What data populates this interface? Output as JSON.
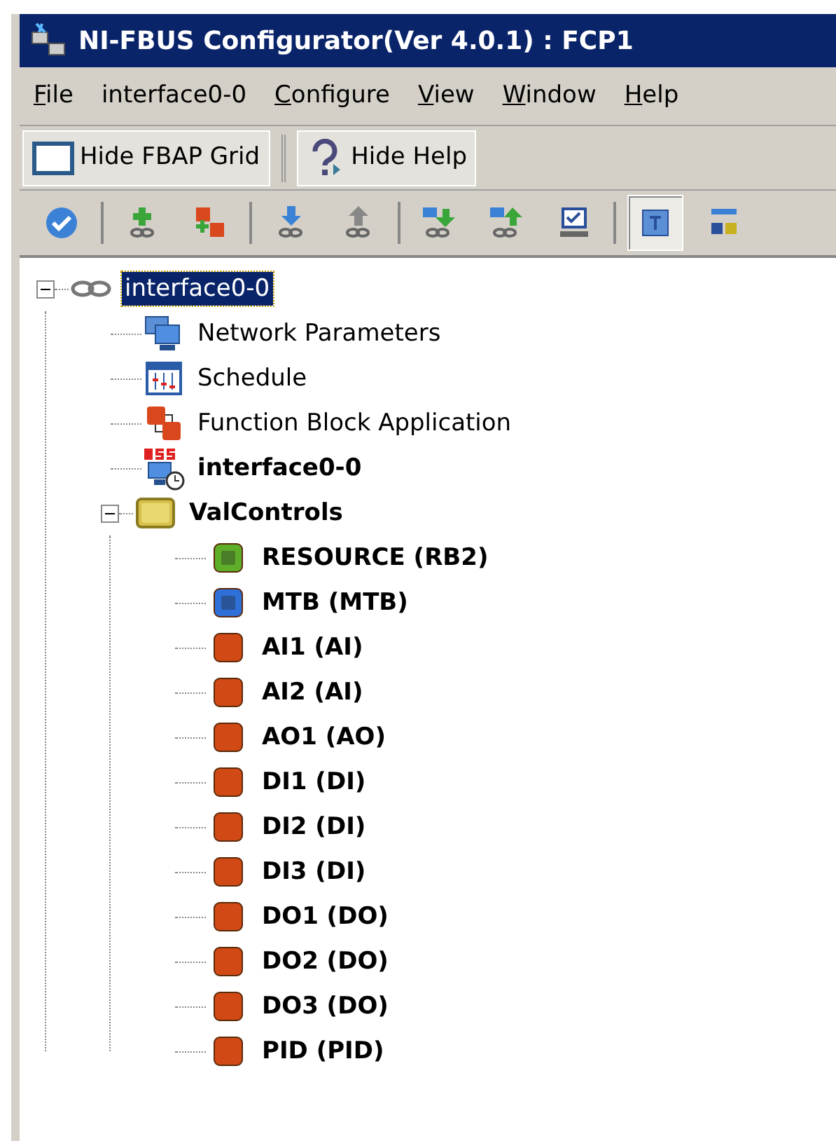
{
  "window": {
    "title": "NI-FBUS Configurator(Ver 4.0.1) : FCP1"
  },
  "menu": [
    {
      "label": "File",
      "mnemonic": true
    },
    {
      "label": "interface0-0",
      "mnemonic": false
    },
    {
      "label": "Configure",
      "mnemonic": true
    },
    {
      "label": "View",
      "mnemonic": true
    },
    {
      "label": "Window",
      "mnemonic": true
    },
    {
      "label": "Help",
      "mnemonic": true
    }
  ],
  "toolbar": [
    {
      "label": "Hide FBAP Grid",
      "kind": "window"
    },
    {
      "label": "Hide Help",
      "kind": "help"
    }
  ],
  "icon_toolbar": [
    {
      "kind": "check",
      "pressed": false
    },
    {
      "kind": "sep"
    },
    {
      "kind": "add-link",
      "pressed": false
    },
    {
      "kind": "add-block",
      "pressed": false
    },
    {
      "kind": "sep"
    },
    {
      "kind": "download",
      "pressed": false
    },
    {
      "kind": "upload",
      "pressed": false
    },
    {
      "kind": "sep"
    },
    {
      "kind": "net-down",
      "pressed": false
    },
    {
      "kind": "net-up",
      "pressed": false
    },
    {
      "kind": "monitor-check",
      "pressed": false
    },
    {
      "kind": "sep"
    },
    {
      "kind": "tag",
      "pressed": true
    },
    {
      "kind": "grid",
      "pressed": false
    }
  ],
  "tree": [
    {
      "label": "interface0-0",
      "kind": "link",
      "bold": false,
      "selected": true,
      "expanded": true,
      "children": [
        {
          "label": "Network Parameters",
          "kind": "network",
          "bold": false,
          "selected": false
        },
        {
          "label": "Schedule",
          "kind": "schedule",
          "bold": false,
          "selected": false
        },
        {
          "label": "Function Block Application",
          "kind": "fba",
          "bold": false,
          "selected": false
        },
        {
          "label": "interface0-0",
          "kind": "las",
          "bold": true,
          "selected": false
        },
        {
          "label": "ValControls",
          "kind": "folder",
          "bold": true,
          "selected": false,
          "expanded": true,
          "children": [
            {
              "label": "RESOURCE (RB2)",
              "kind": "resource",
              "bold": true,
              "selected": false
            },
            {
              "label": "MTB (MTB)",
              "kind": "transducer",
              "bold": true,
              "selected": false
            },
            {
              "label": "AI1 (AI)",
              "kind": "block",
              "bold": true,
              "selected": false
            },
            {
              "label": "AI2 (AI)",
              "kind": "block",
              "bold": true,
              "selected": false
            },
            {
              "label": "AO1 (AO)",
              "kind": "block",
              "bold": true,
              "selected": false
            },
            {
              "label": "DI1 (DI)",
              "kind": "block",
              "bold": true,
              "selected": false
            },
            {
              "label": "DI2 (DI)",
              "kind": "block",
              "bold": true,
              "selected": false
            },
            {
              "label": "DI3 (DI)",
              "kind": "block",
              "bold": true,
              "selected": false
            },
            {
              "label": "DO1 (DO)",
              "kind": "block",
              "bold": true,
              "selected": false
            },
            {
              "label": "DO2 (DO)",
              "kind": "block",
              "bold": true,
              "selected": false
            },
            {
              "label": "DO3 (DO)",
              "kind": "block",
              "bold": true,
              "selected": false
            },
            {
              "label": "PID (PID)",
              "kind": "block",
              "bold": true,
              "selected": false
            }
          ]
        }
      ]
    }
  ]
}
